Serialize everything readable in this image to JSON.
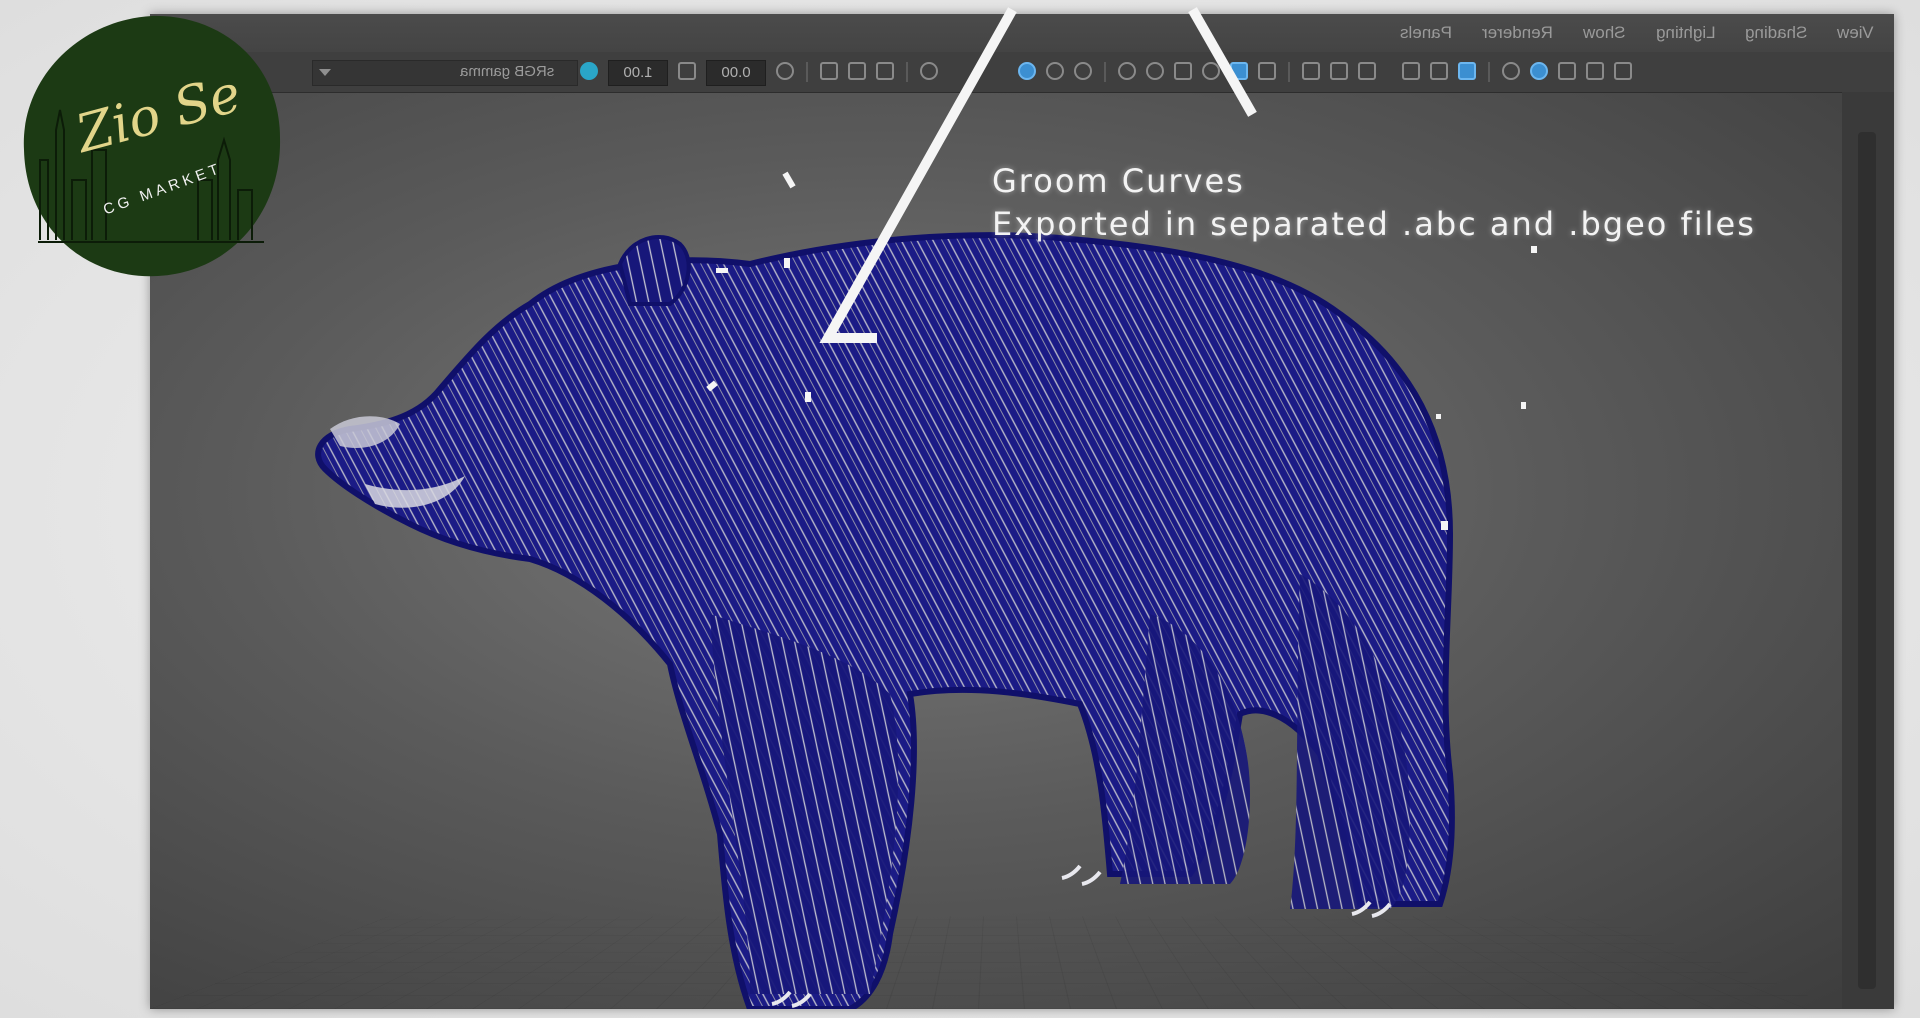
{
  "logo": {
    "name": "Zio Se",
    "tagline": "CG MARKET",
    "background_color": "#1c3a14",
    "text_color": "#e2d58a"
  },
  "viewport": {
    "menu": [
      "View",
      "Shading",
      "Lighting",
      "Show",
      "Renderer",
      "Panels"
    ],
    "toolbar": {
      "gamma_label": "sRGB gamma",
      "exposure_value": "0.00",
      "gamma_value": "1.00"
    },
    "accent_color": "#3c8fd1"
  },
  "annotation": {
    "line1": "Groom Curves",
    "line2": "Exported in separated .abc and .bgeo files"
  },
  "subject": {
    "fur_color": "#1a1a8a"
  }
}
